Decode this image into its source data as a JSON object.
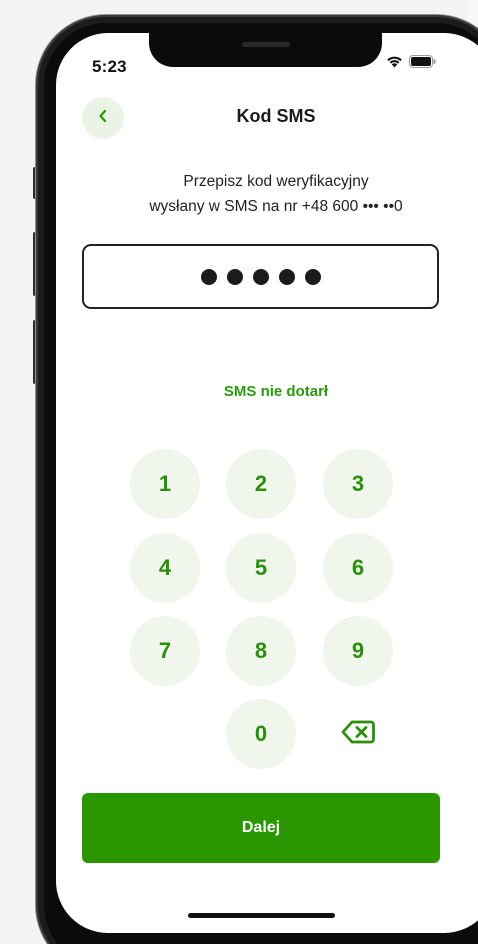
{
  "status_bar": {
    "time": "5:23"
  },
  "header": {
    "title": "Kod SMS",
    "back_icon": "chevron-left-icon"
  },
  "instruction": {
    "line1": "Przepisz kod weryfikacyjny",
    "line2": "wysłany w SMS na nr +48 600 ••• ••0"
  },
  "code_input": {
    "masked_digits": 5
  },
  "resend_link": "SMS nie dotarł",
  "keypad": {
    "keys": [
      "1",
      "2",
      "3",
      "4",
      "5",
      "6",
      "7",
      "8",
      "9",
      "0"
    ],
    "delete_icon": "backspace-icon"
  },
  "primary_button": {
    "label": "Dalej"
  },
  "colors": {
    "accent": "#2a9700",
    "accent_text": "#2a8f0d",
    "key_bg": "#f0f6ec",
    "back_bg": "#eaf3e6"
  }
}
